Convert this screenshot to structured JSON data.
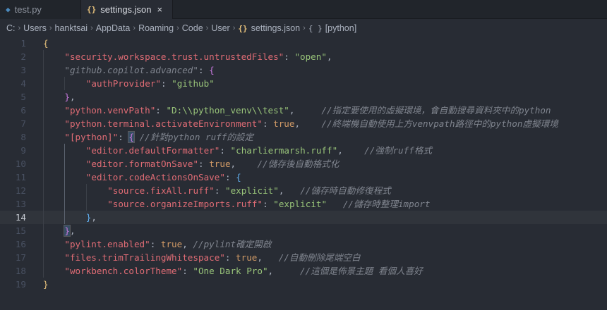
{
  "tabs": [
    {
      "label": "test.py",
      "icon": "python-icon"
    },
    {
      "label": "settings.json",
      "icon": "json-braces-icon",
      "close": "×"
    }
  ],
  "breadcrumb": [
    "C:",
    "Users",
    "hanktsai",
    "AppData",
    "Roaming",
    "Code",
    "User",
    "settings.json",
    "[python]"
  ],
  "breadcrumb_icons": {
    "file": "{}",
    "object": "{ }"
  },
  "colors": {
    "key": "#e06c75",
    "string": "#98c379",
    "comment": "#7f848e",
    "bool": "#d19a66",
    "bracket1": "#e5c07b",
    "bracket2": "#c678dd",
    "bracket3": "#61afef",
    "background": "#282c34"
  },
  "current_line": 14,
  "code_lines": [
    {
      "n": "1",
      "indent": 0,
      "tokens": [
        {
          "t": "b1",
          "v": "{"
        }
      ]
    },
    {
      "n": "2",
      "indent": 1,
      "tokens": [
        {
          "t": "k",
          "v": "\"security.workspace.trust.untrustedFiles\""
        },
        {
          "t": "p",
          "v": ": "
        },
        {
          "t": "s",
          "v": "\"open\""
        },
        {
          "t": "p",
          "v": ","
        }
      ]
    },
    {
      "n": "3",
      "indent": 1,
      "tokens": [
        {
          "t": "c",
          "v": "\"github.copilot.advanced\""
        },
        {
          "t": "p",
          "v": ": "
        },
        {
          "t": "b2",
          "v": "{"
        }
      ]
    },
    {
      "n": "4",
      "indent": 2,
      "tokens": [
        {
          "t": "k",
          "v": "\"authProvider\""
        },
        {
          "t": "p",
          "v": ": "
        },
        {
          "t": "s",
          "v": "\"github\""
        }
      ]
    },
    {
      "n": "5",
      "indent": 1,
      "tokens": [
        {
          "t": "b2",
          "v": "}"
        },
        {
          "t": "p",
          "v": ","
        }
      ]
    },
    {
      "n": "6",
      "indent": 1,
      "tokens": [
        {
          "t": "k",
          "v": "\"python.venvPath\""
        },
        {
          "t": "p",
          "v": ": "
        },
        {
          "t": "s",
          "v": "\"D:\\\\python_venv\\\\test\""
        },
        {
          "t": "p",
          "v": ",     "
        },
        {
          "t": "c",
          "v": "//指定要使用的虛擬環境，會自動搜尋資料夾中的python"
        }
      ]
    },
    {
      "n": "7",
      "indent": 1,
      "tokens": [
        {
          "t": "k",
          "v": "\"python.terminal.activateEnvironment\""
        },
        {
          "t": "p",
          "v": ": "
        },
        {
          "t": "n",
          "v": "true"
        },
        {
          "t": "p",
          "v": ",    "
        },
        {
          "t": "c",
          "v": "//終端機自動使用上方venvpath路徑中的python虛擬環境"
        }
      ]
    },
    {
      "n": "8",
      "indent": 1,
      "tokens": [
        {
          "t": "k",
          "v": "\"[python]\""
        },
        {
          "t": "p",
          "v": ": "
        },
        {
          "t": "b2 bhl",
          "v": "{"
        },
        {
          "t": "p",
          "v": " "
        },
        {
          "t": "c",
          "v": "//針對python ruff的設定"
        }
      ]
    },
    {
      "n": "9",
      "indent": 2,
      "tokens": [
        {
          "t": "k",
          "v": "\"editor.defaultFormatter\""
        },
        {
          "t": "p",
          "v": ": "
        },
        {
          "t": "s",
          "v": "\"charliermarsh.ruff\""
        },
        {
          "t": "p",
          "v": ",    "
        },
        {
          "t": "c",
          "v": "//強制ruff格式"
        }
      ]
    },
    {
      "n": "10",
      "indent": 2,
      "tokens": [
        {
          "t": "k",
          "v": "\"editor.formatOnSave\""
        },
        {
          "t": "p",
          "v": ": "
        },
        {
          "t": "n",
          "v": "true"
        },
        {
          "t": "p",
          "v": ",    "
        },
        {
          "t": "c",
          "v": "//儲存後自動格式化"
        }
      ]
    },
    {
      "n": "11",
      "indent": 2,
      "tokens": [
        {
          "t": "k",
          "v": "\"editor.codeActionsOnSave\""
        },
        {
          "t": "p",
          "v": ": "
        },
        {
          "t": "b3",
          "v": "{"
        }
      ]
    },
    {
      "n": "12",
      "indent": 3,
      "tokens": [
        {
          "t": "k",
          "v": "\"source.fixAll.ruff\""
        },
        {
          "t": "p",
          "v": ": "
        },
        {
          "t": "s",
          "v": "\"explicit\""
        },
        {
          "t": "p",
          "v": ",   "
        },
        {
          "t": "c",
          "v": "//儲存時自動修復程式"
        }
      ]
    },
    {
      "n": "13",
      "indent": 3,
      "tokens": [
        {
          "t": "k",
          "v": "\"source.organizeImports.ruff\""
        },
        {
          "t": "p",
          "v": ": "
        },
        {
          "t": "s",
          "v": "\"explicit\""
        },
        {
          "t": "p",
          "v": "   "
        },
        {
          "t": "c",
          "v": "//儲存時整理import"
        }
      ]
    },
    {
      "n": "14",
      "indent": 2,
      "tokens": [
        {
          "t": "b3",
          "v": "}"
        },
        {
          "t": "p",
          "v": ","
        }
      ]
    },
    {
      "n": "15",
      "indent": 1,
      "tokens": [
        {
          "t": "b2 bhl",
          "v": "}"
        },
        {
          "t": "p",
          "v": ","
        }
      ]
    },
    {
      "n": "16",
      "indent": 1,
      "tokens": [
        {
          "t": "k",
          "v": "\"pylint.enabled\""
        },
        {
          "t": "p",
          "v": ": "
        },
        {
          "t": "n",
          "v": "true"
        },
        {
          "t": "p",
          "v": ", "
        },
        {
          "t": "c",
          "v": "//pylint確定開啟"
        }
      ]
    },
    {
      "n": "17",
      "indent": 1,
      "tokens": [
        {
          "t": "k",
          "v": "\"files.trimTrailingWhitespace\""
        },
        {
          "t": "p",
          "v": ": "
        },
        {
          "t": "n",
          "v": "true"
        },
        {
          "t": "p",
          "v": ",   "
        },
        {
          "t": "c",
          "v": "//自動刪除尾端空白"
        }
      ]
    },
    {
      "n": "18",
      "indent": 1,
      "tokens": [
        {
          "t": "k",
          "v": "\"workbench.colorTheme\""
        },
        {
          "t": "p",
          "v": ": "
        },
        {
          "t": "s",
          "v": "\"One Dark Pro\""
        },
        {
          "t": "p",
          "v": ",     "
        },
        {
          "t": "c",
          "v": "//這個是佈景主題 看個人喜好"
        }
      ]
    },
    {
      "n": "19",
      "indent": 0,
      "tokens": [
        {
          "t": "b1",
          "v": "}"
        }
      ]
    }
  ]
}
